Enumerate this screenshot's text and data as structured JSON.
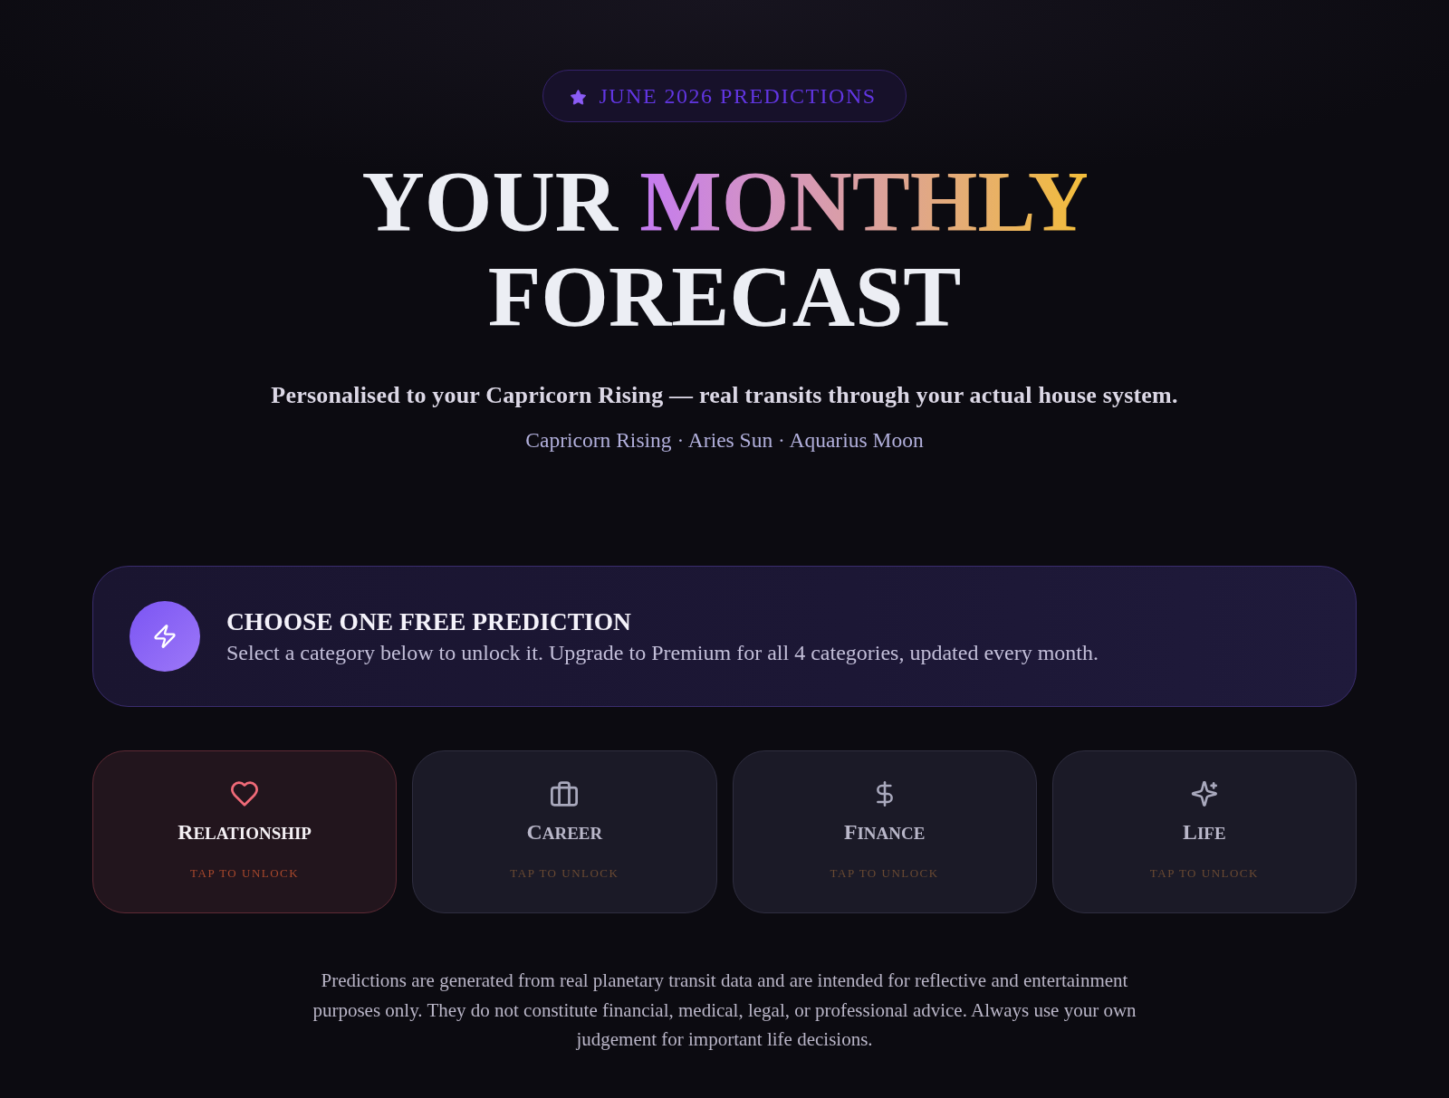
{
  "badge": {
    "text": "JUNE 2026 PREDICTIONS"
  },
  "title": [
    {
      "text": "YOUR",
      "highlighted": false
    },
    {
      "text": "MONTHLY",
      "highlighted": true
    },
    {
      "text": "FORECAST",
      "highlighted": false
    }
  ],
  "subtitle": "Personalised to your Capricorn Rising — real transits through your actual house system.",
  "placements": "Capricorn Rising · Aries Sun · Aquarius Moon",
  "offer_banner": {
    "heading": "CHOOSE ONE FREE PREDICTION",
    "description": "Select a category below to unlock it. Upgrade to Premium for all 4 categories, updated every month."
  },
  "categories": [
    {
      "kind": "relationship",
      "name": "RELATIONSHIP",
      "hint": "TAP TO UNLOCK",
      "selected": true
    },
    {
      "kind": "career",
      "name": "CAREER",
      "hint": "TAP TO UNLOCK",
      "selected": false
    },
    {
      "kind": "finance",
      "name": "FINANCE",
      "hint": "TAP TO UNLOCK",
      "selected": false
    },
    {
      "kind": "life",
      "name": "LIFE",
      "hint": "TAP TO UNLOCK",
      "selected": false
    }
  ],
  "disclaimer": "Predictions are generated from real planetary transit data and are intended for reflective and entertainment purposes only. They do not constitute financial, medical, legal, or professional advice. Always use your own judgement for important life decisions."
}
